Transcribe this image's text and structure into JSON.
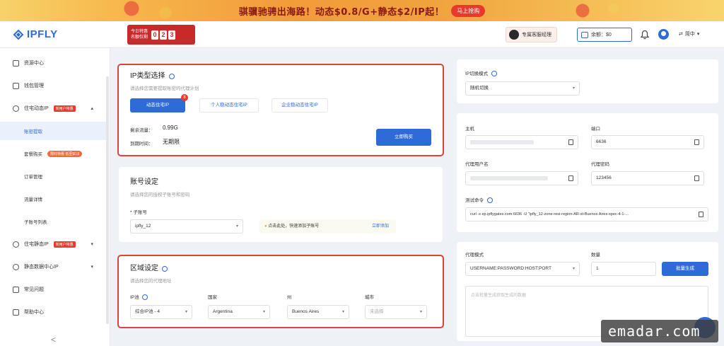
{
  "banner": {
    "text": "骐骥驰骋出海路！动态$0.8/G+静态$2/IP起！",
    "button": "马上抢购"
  },
  "header": {
    "logo": "IPFLY",
    "promo_line1": "今日特惠",
    "promo_line2": "名额仅剩",
    "promo_digits": [
      "0",
      "2",
      "3"
    ],
    "advisor": "专属客服经理",
    "balance": "余额：$0",
    "language": "简中"
  },
  "sidebar": {
    "items": [
      {
        "label": "资源中心"
      },
      {
        "label": "钱包管理"
      },
      {
        "label": "住宅动态IP",
        "tag": "新用户特惠"
      },
      {
        "label": "账密提取"
      },
      {
        "label": "套餐购买",
        "tag": "限时特惠 低至$0.8"
      },
      {
        "label": "订单管理"
      },
      {
        "label": "流量详情"
      },
      {
        "label": "子账号列表"
      },
      {
        "label": "住宅静态IP",
        "tag": "新用户特惠"
      },
      {
        "label": "静态数据中心IP"
      },
      {
        "label": "常见问题"
      },
      {
        "label": "帮助中心"
      }
    ],
    "collapse": "<"
  },
  "ip_type": {
    "title": "IP类型选择",
    "subtitle": "请选择您需要提取账密的代理计划",
    "options": [
      "动态住宅IP",
      "个人稳动态住宅IP",
      "企业稳动态住宅IP"
    ],
    "badge": "8",
    "remaining_label": "剩余流量：",
    "remaining_value": "0.99G",
    "expiry_label": "到期时间：",
    "expiry_value": "无期限",
    "buy_button": "立即购买"
  },
  "account": {
    "title": "账号设定",
    "subtitle": "请选择您的授权子账号和密码",
    "sub_account_label": "* 子账号",
    "sub_account_value": "ipfly_12",
    "tip_text": "点击此处，快速添加子账号",
    "tip_link": "立即添加"
  },
  "region": {
    "title": "区域设定",
    "subtitle": "请选择您的代理地址",
    "pool_label": "IP池",
    "pool_value": "综合IP池 - 4",
    "country_label": "国家",
    "country_value": "Argentina",
    "state_label": "州",
    "state_value": "Buenos Aires",
    "city_label": "城市",
    "city_placeholder": "未选择"
  },
  "right": {
    "switch_mode_label": "IP切换模式",
    "switch_mode_value": "随机切换",
    "host_label": "主机",
    "port_label": "端口",
    "port_value": "6636",
    "proxy_user_label": "代理用户名",
    "proxy_pass_label": "代理密码",
    "proxy_pass_value": "123456",
    "test_cmd_label": "测试命令",
    "test_cmd_value": "curl -x ep.ipflygates.com:6636 -U \"ipfly_12-zone-resi-region-AR-st-Buenos Aires-spec-4-1-...",
    "proxy_mode_label": "代理模式",
    "proxy_mode_value": "USERNAME:PASSWORD:HOST:PORT",
    "quantity_label": "数量",
    "quantity_value": "1",
    "generate_button": "批量生成",
    "output_placeholder": "点击批量生成获取生成的数据"
  },
  "watermark": "emadar.com",
  "colors": {
    "accent": "#2e6bd9",
    "highlight": "#d9453b",
    "promo": "#c82a2a"
  }
}
